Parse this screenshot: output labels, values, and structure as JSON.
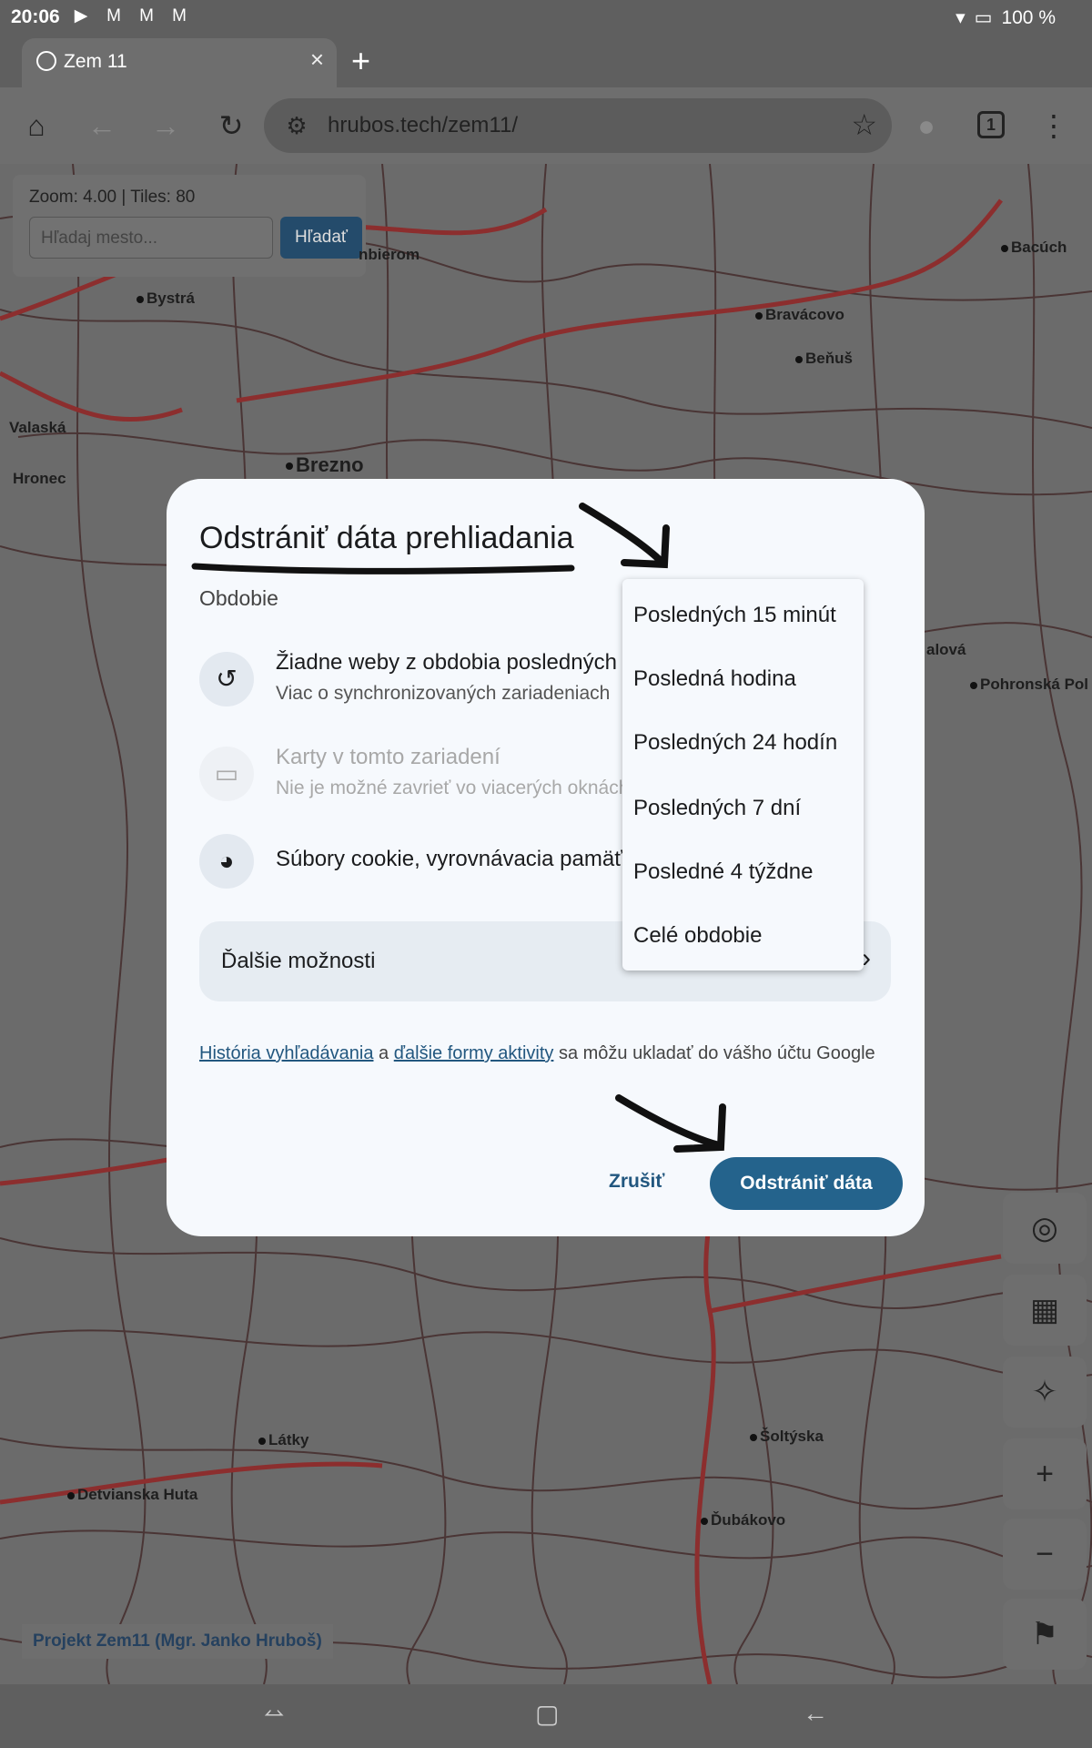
{
  "status_bar": {
    "time": "20:06",
    "battery": "100 %"
  },
  "browser": {
    "tab_title": "Zem 11",
    "url": "hrubos.tech/zem11/",
    "tab_count": "1"
  },
  "map": {
    "zoom_info": "Zoom: 4.00  |  Tiles: 80",
    "search_placeholder": "Hľadaj mesto...",
    "search_button": "Hľadať",
    "credit": "Projekt Zem11 (Mgr. Janko Hruboš)",
    "labels": {
      "bystra": "Bystrá",
      "nbierom": "nbierom",
      "bacuch": "Bacúch",
      "bravacovo": "Bravácovo",
      "benus": "Beňuš",
      "valaska": "Valaská",
      "brezno": "Brezno",
      "hronec": "Hronec",
      "halova": "alová",
      "pohronska": "Pohronská Pol",
      "latky": "Látky",
      "detvianska": "Detvianska Huta",
      "soltyska": "Šoltýska",
      "dubakovo": "Ďubákovo"
    }
  },
  "dialog": {
    "title": "Odstrániť dáta prehliadania",
    "period_label": "Obdobie",
    "rows": [
      {
        "title": "Žiadne weby z obdobia posledných",
        "subtitle": "Viac o synchronizovaných zariadeniach"
      },
      {
        "title": "Karty v tomto zariadení",
        "subtitle": "Nie je možné zavrieť vo viacerých oknách"
      },
      {
        "title": "Súbory cookie, vyrovnávacia pamäť"
      }
    ],
    "more_options": "Ďalšie možnosti",
    "note": {
      "link1": "História vyhľadávania",
      "and": " a ",
      "link2": "ďalšie formy aktivity",
      "rest": " sa môžu ukladať do vášho účtu Google"
    },
    "cancel": "Zrušiť",
    "confirm": "Odstrániť dáta"
  },
  "period_menu": {
    "options": [
      "Posledných 15 minút",
      "Posledná hodina",
      "Posledných 24 hodín",
      "Posledných 7 dní",
      "Posledné 4 týždne",
      "Celé obdobie"
    ]
  }
}
